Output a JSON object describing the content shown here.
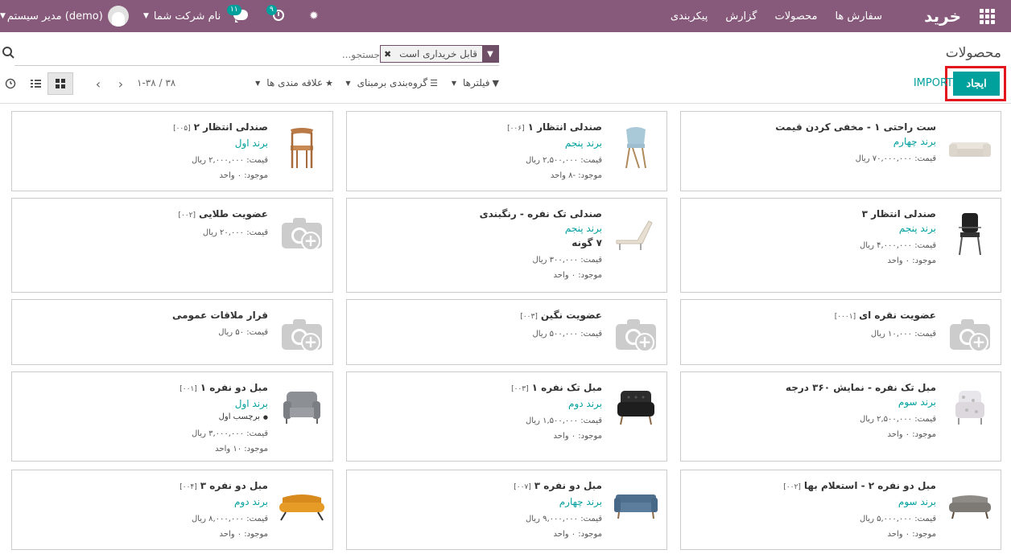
{
  "navbar": {
    "brand": "خرید",
    "menu": [
      "سفارش ها",
      "محصولات",
      "گزارش",
      "پیکربندی"
    ],
    "activity_count": "۹",
    "message_count": "۱۱",
    "company": "نام شرکت شما",
    "user": "مدیر سیستم (demo)",
    "accent": "#875a7b"
  },
  "control": {
    "breadcrumb": "محصولات",
    "create_label": "ایجاد",
    "import_label": "IMPORT",
    "facet_value": "قابل خریداری است",
    "search_placeholder": "جستجو...",
    "filters_label": "فیلترها",
    "groupby_label": "گروه‌بندی برمبنای",
    "favorites_label": "علاقه مندی ها",
    "pager": "۱-۳۸ / ۳۸"
  },
  "cards": [
    {
      "name": "ست راحتی ۱ - مخفی کردن قیمت",
      "code": "",
      "brand": "برند چهارم",
      "variants": "",
      "tag": "",
      "lines": [
        "قیمت: ۷۰,۰۰۰,۰۰۰ ریال"
      ],
      "img": "sofa-white"
    },
    {
      "name": "صندلی انتظار ۱",
      "code": "[۰۰۶]",
      "brand": "برند پنجم",
      "variants": "",
      "tag": "",
      "lines": [
        "قیمت: ۲,۵۰۰,۰۰۰ ریال",
        "موجود: -۸ واحد"
      ],
      "img": "chair-blue"
    },
    {
      "name": "صندلی انتظار ۲",
      "code": "[۰۰۵]",
      "brand": "برند اول",
      "variants": "",
      "tag": "",
      "lines": [
        "قیمت: ۲,۰۰۰,۰۰۰ ریال",
        "موجود: ۰ واحد"
      ],
      "img": "chair-wood"
    },
    {
      "name": "صندلی انتظار ۳",
      "code": "",
      "brand": "برند پنجم",
      "variants": "",
      "tag": "",
      "lines": [
        "قیمت: ۴,۰۰۰,۰۰۰ ریال",
        "موجود: ۰ واحد"
      ],
      "img": "chair-office"
    },
    {
      "name": "صندلی تک نفره - رنگبندی",
      "code": "",
      "brand": "برند پنجم",
      "variants": "۷ گونه",
      "tag": "",
      "lines": [
        "قیمت: ۳۰۰,۰۰۰ ریال",
        "موجود: ۰ واحد"
      ],
      "img": "lounger"
    },
    {
      "name": "عضویت طلایی",
      "code": "[۰۰۲]",
      "brand": "",
      "variants": "",
      "tag": "",
      "lines": [
        "قیمت: ۲۰,۰۰۰ ریال"
      ],
      "img": "placeholder"
    },
    {
      "name": "عضویت نقره ای",
      "code": "[۰۰۰۱]",
      "brand": "",
      "variants": "",
      "tag": "",
      "lines": [
        "قیمت: ۱۰,۰۰۰ ریال"
      ],
      "img": "placeholder"
    },
    {
      "name": "عضویت نگین",
      "code": "[۰۰۳]",
      "brand": "",
      "variants": "",
      "tag": "",
      "lines": [
        "قیمت: ۵۰۰,۰۰۰ ریال"
      ],
      "img": "placeholder"
    },
    {
      "name": "قرار ملاقات عمومی",
      "code": "",
      "brand": "",
      "variants": "",
      "tag": "",
      "lines": [
        "قیمت: ۵۰ ریال"
      ],
      "img": "placeholder"
    },
    {
      "name": "مبل تک نفره - نمایش ۳۶۰ درجه",
      "code": "",
      "brand": "برند سوم",
      "variants": "",
      "tag": "",
      "lines": [
        "قیمت: ۲,۵۰۰,۰۰۰ ریال",
        "موجود: ۰ واحد"
      ],
      "img": "armchair-pattern"
    },
    {
      "name": "مبل تک نفره ۱",
      "code": "[۰۰۳]",
      "brand": "برند دوم",
      "variants": "",
      "tag": "",
      "lines": [
        "قیمت: ۱,۵۰۰,۰۰۰ ریال",
        "موجود: ۰ واحد"
      ],
      "img": "armchair-black"
    },
    {
      "name": "مبل دو نفره ۱",
      "code": "[۰۰۱]",
      "brand": "برند اول",
      "variants": "",
      "tag": "برچسب اول",
      "lines": [
        "قیمت: ۳,۰۰۰,۰۰۰ ریال",
        "موجود: ۱۰ واحد"
      ],
      "img": "loveseat-grey"
    },
    {
      "name": "مبل دو نفره ۲ - استعلام بها",
      "code": "[۰۰۲]",
      "brand": "برند سوم",
      "variants": "",
      "tag": "",
      "lines": [
        "قیمت: ۵,۰۰۰,۰۰۰ ریال",
        "موجود: ۰ واحد"
      ],
      "img": "sofa-grey"
    },
    {
      "name": "مبل دو نفره ۳",
      "code": "[۰۰۷]",
      "brand": "برند چهارم",
      "variants": "",
      "tag": "",
      "lines": [
        "قیمت: ۹,۰۰۰,۰۰۰ ریال",
        "موجود: ۰ واحد"
      ],
      "img": "sofa-blue"
    },
    {
      "name": "مبل دو نفره ۳",
      "code": "[۰۰۴]",
      "brand": "برند دوم",
      "variants": "",
      "tag": "",
      "lines": [
        "قیمت: ۸,۰۰۰,۰۰۰ ریال",
        "موجود: ۰ واحد"
      ],
      "img": "sofa-orange"
    }
  ]
}
